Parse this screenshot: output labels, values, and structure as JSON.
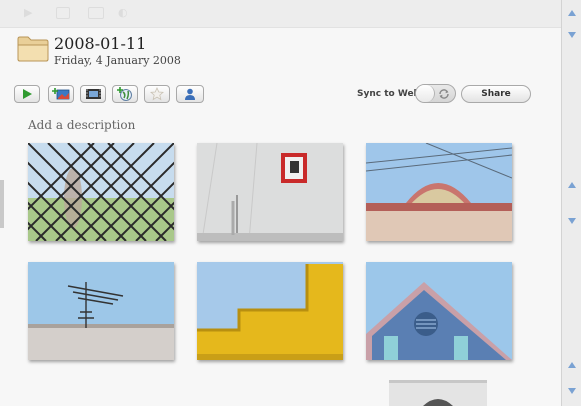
{
  "header": {
    "title": "2008-01-11",
    "subtitle": "Friday, 4 January 2008"
  },
  "toolbar": {
    "sync_label": "Sync to Web",
    "share_label": "Share"
  },
  "main": {
    "description_placeholder": "Add a description"
  },
  "photos": [
    "chain-link-fence",
    "white-wall-red-window",
    "arched-parapet",
    "tv-antenna",
    "yellow-stepped-wall",
    "blue-gable-vent",
    "white-building-partial"
  ],
  "colors": {
    "accent_green": "#2f9a2f",
    "sky_blue": "#9fc6ea",
    "text_dark": "#222222"
  }
}
